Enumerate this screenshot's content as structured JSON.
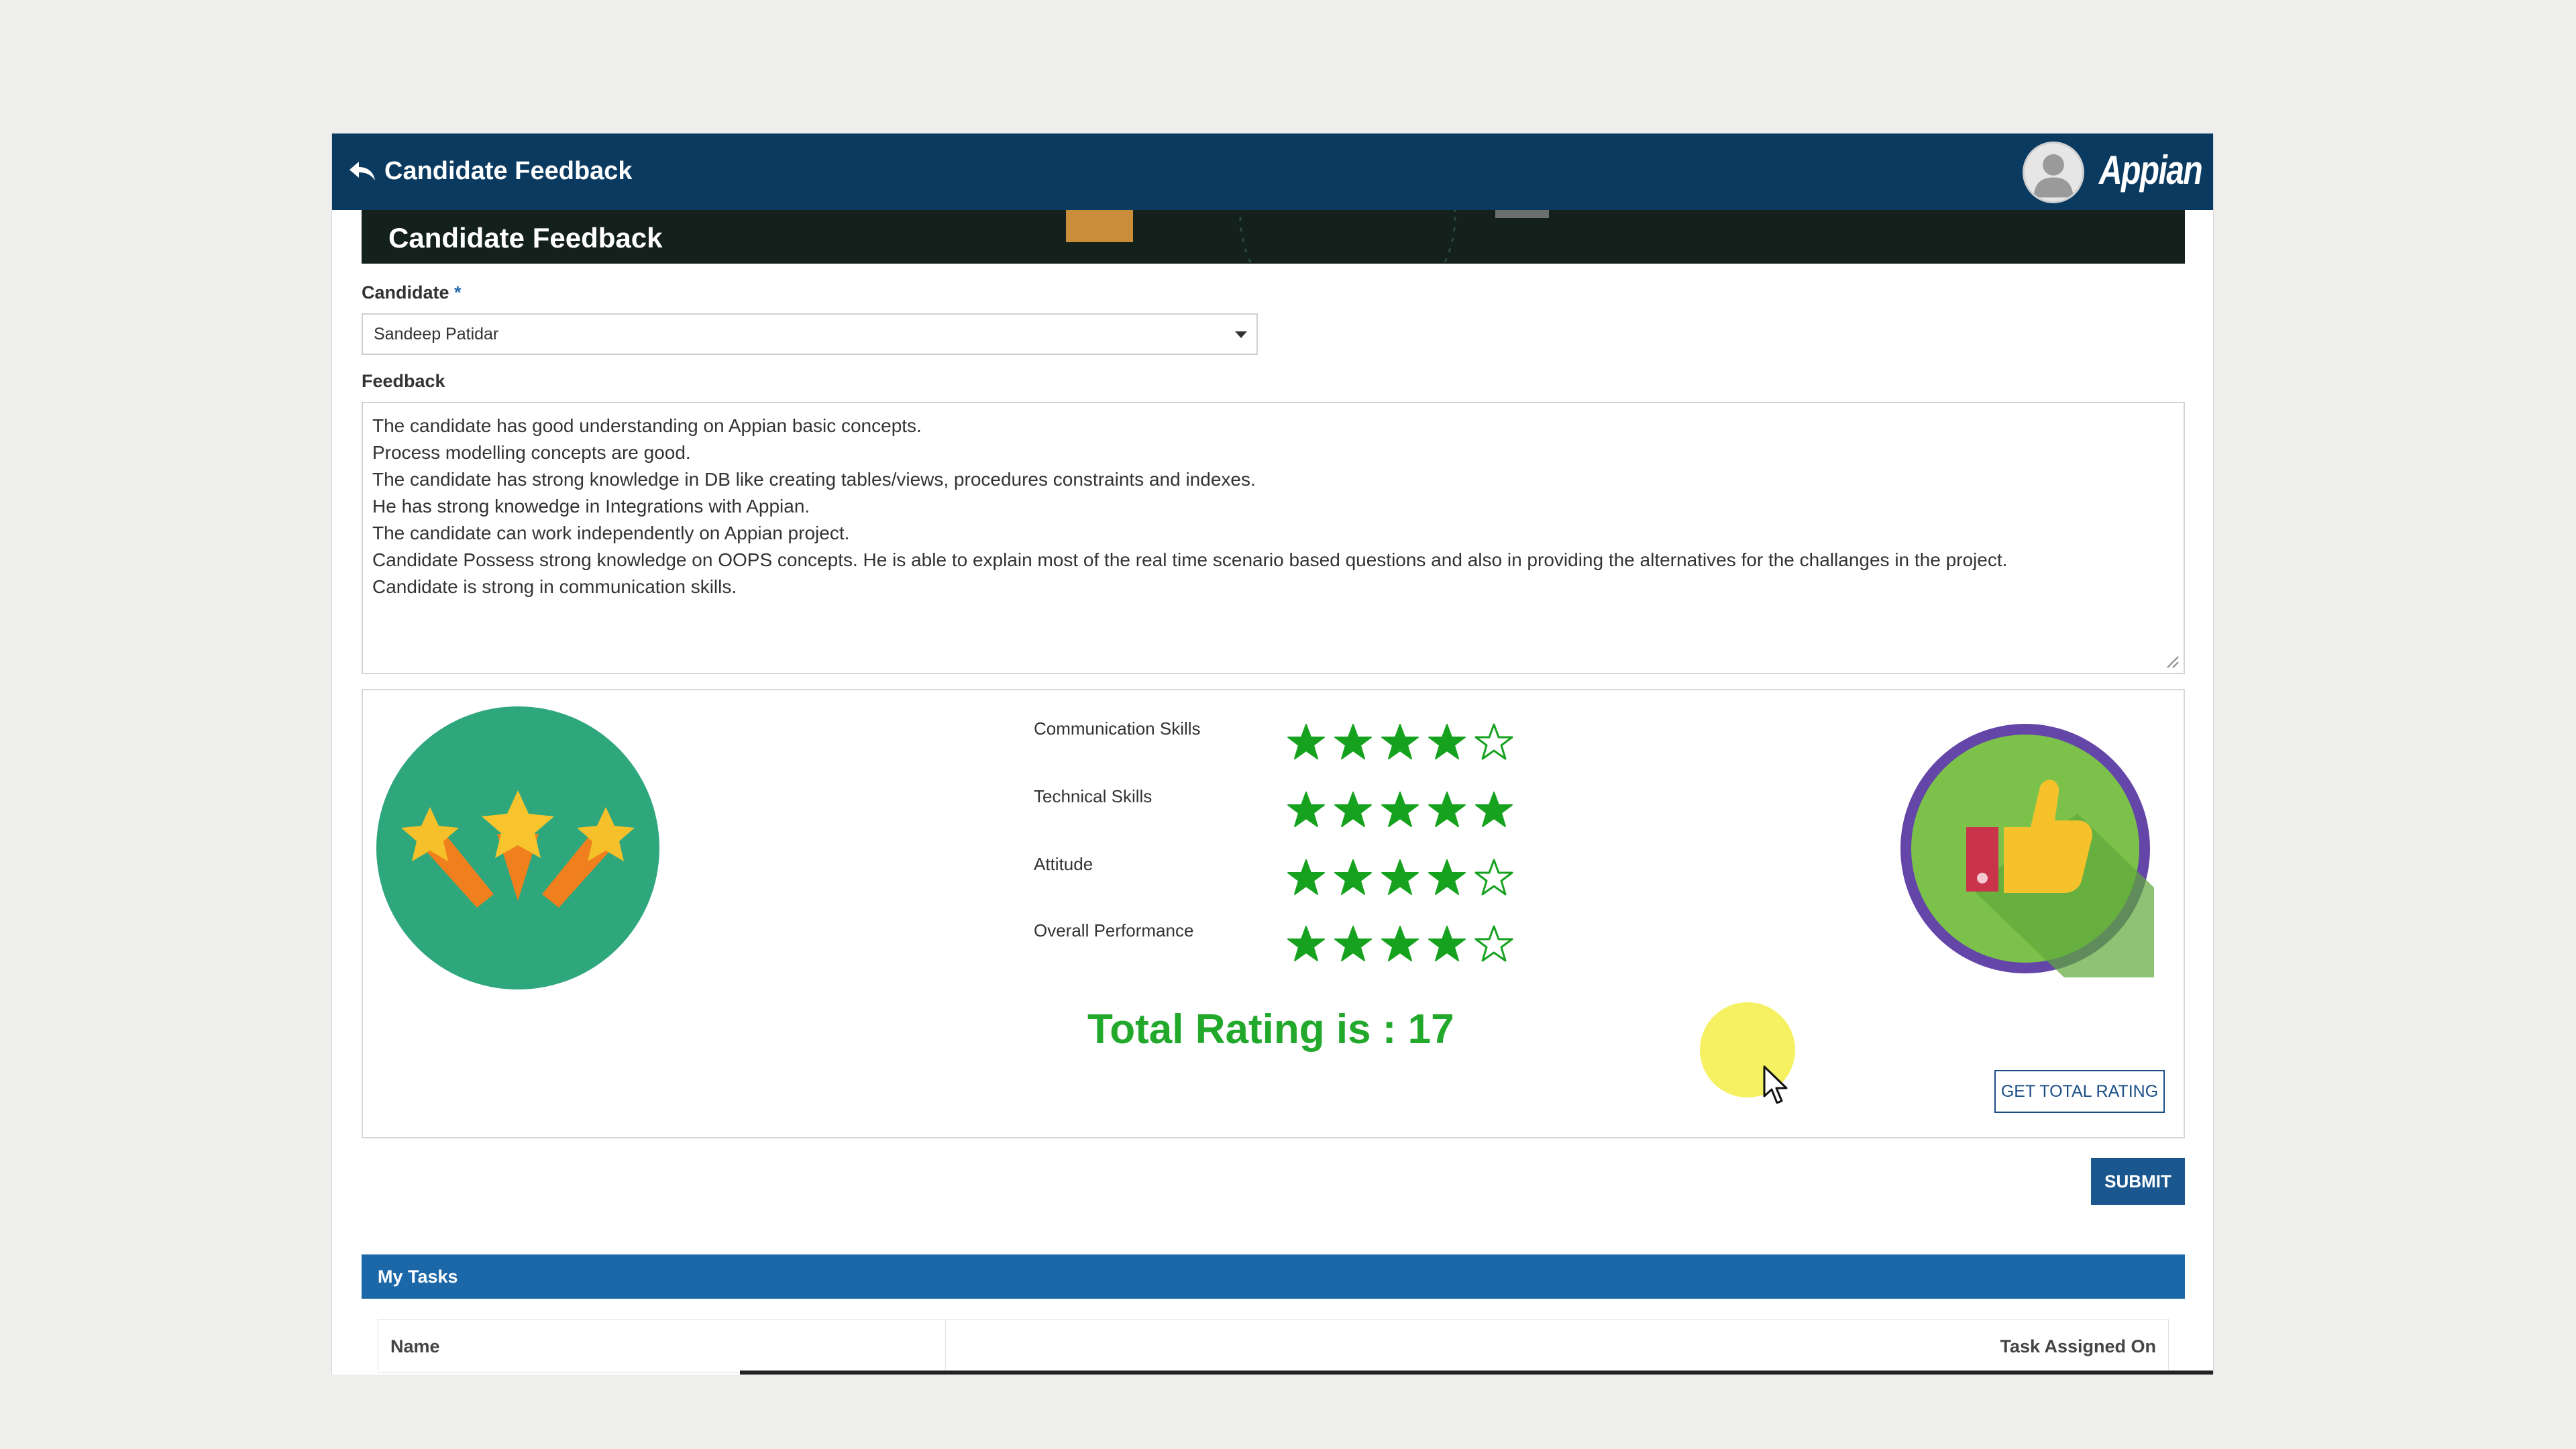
{
  "header": {
    "title": "Candidate Feedback",
    "logo": "Appian",
    "back_icon": "back-arrow-icon",
    "avatar_icon": "user-avatar-icon"
  },
  "banner": {
    "title": "Candidate Feedback"
  },
  "form": {
    "candidate_label": "Candidate",
    "required_mark": "*",
    "candidate_value": "Sandeep Patidar",
    "feedback_label": "Feedback",
    "feedback_lines": [
      "The candidate has good understanding on Appian basic concepts.",
      "Process modelling concepts are good.",
      "The candidate has strong knowledge in DB like creating tables/views, procedures constraints and indexes.",
      "He has strong knowedge in Integrations with Appian.",
      "The candidate can work independently on Appian project.",
      "Candidate Possess strong knowledge on OOPS concepts. He is able to explain most of the real time scenario based questions and also in providing the alternatives for the challanges in the project.",
      "Candidate is strong in communication skills."
    ]
  },
  "ratings": [
    {
      "label": "Communication Skills",
      "value": 4,
      "max": 5
    },
    {
      "label": "Technical Skills",
      "value": 5,
      "max": 5
    },
    {
      "label": "Attitude",
      "value": 4,
      "max": 5
    },
    {
      "label": "Overall Performance",
      "value": 4,
      "max": 5
    }
  ],
  "total_rating_text": "Total Rating is : 17",
  "buttons": {
    "get_total": "GET TOTAL RATING",
    "submit": "SUBMIT"
  },
  "tasks": {
    "title": "My Tasks",
    "columns": [
      "Name",
      "Task Assigned On"
    ]
  },
  "colors": {
    "topbar": "#0b3a61",
    "star_green": "#16a21e",
    "total_green": "#22a82b",
    "tasks_header": "#1c67a8",
    "submit": "#1b578f"
  }
}
